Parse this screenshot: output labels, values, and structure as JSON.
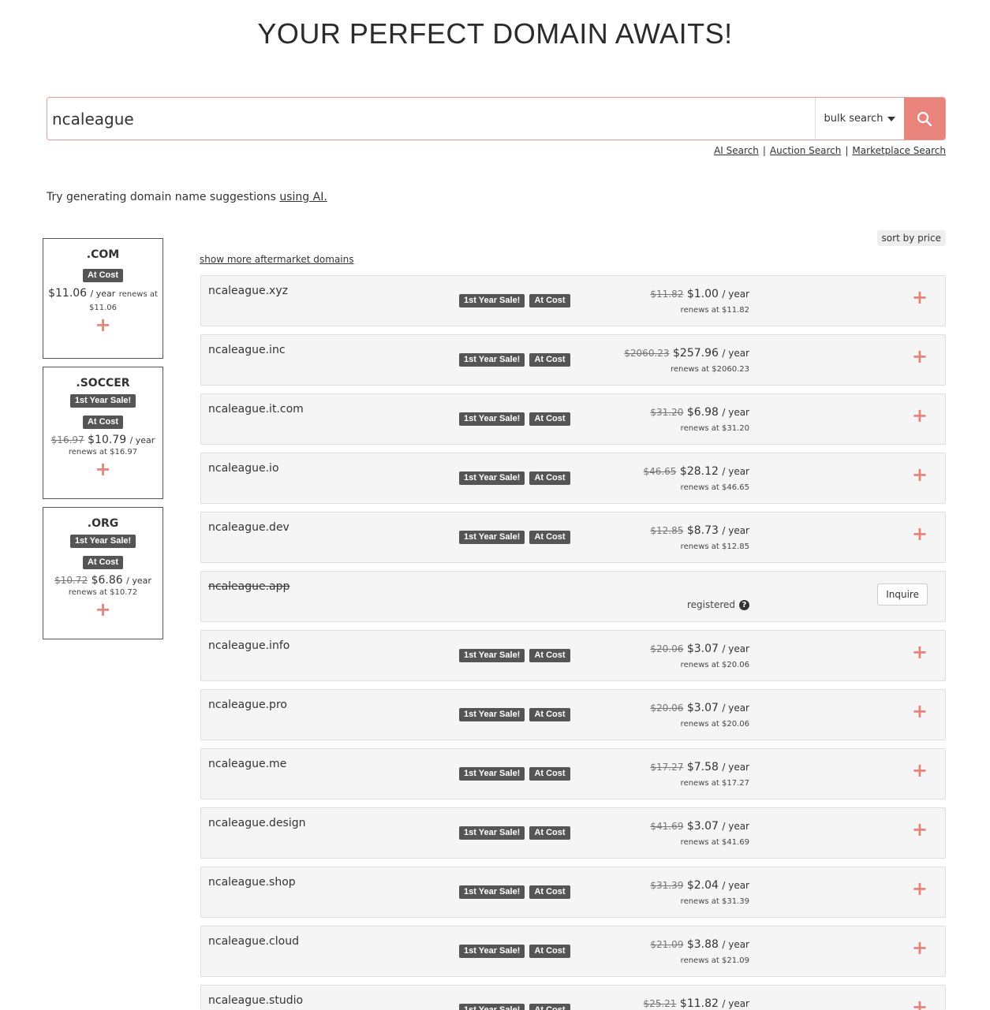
{
  "title": "YOUR PERFECT DOMAIN AWAITS!",
  "search": {
    "value": "ncaleague",
    "bulk_label": "bulk search",
    "links": [
      "AI Search",
      "Auction Search",
      "Marketplace Search"
    ]
  },
  "ai_hint": {
    "text": "Try generating domain name suggestions",
    "link": "using AI."
  },
  "tld_cards": [
    {
      "tld": ".COM",
      "badges": [
        "At Cost"
      ],
      "old_price": "",
      "price": "$11.06",
      "per": "/ year",
      "renews": "renews at $11.06"
    },
    {
      "tld": ".SOCCER",
      "badges": [
        "1st Year Sale!",
        "At Cost"
      ],
      "old_price": "$16.97",
      "price": "$10.79",
      "per": "/ year",
      "renews": "renews at $16.97"
    },
    {
      "tld": ".ORG",
      "badges": [
        "1st Year Sale!",
        "At Cost"
      ],
      "old_price": "$10.72",
      "price": "$6.86",
      "per": "/ year",
      "renews": "renews at $10.72"
    }
  ],
  "sort_label": "sort by price",
  "more_link": "show more aftermarket domains",
  "badge_labels": {
    "sale": "1st Year Sale!",
    "cost": "At Cost"
  },
  "per_year": "/ year",
  "results": [
    {
      "domain": "ncaleague.xyz",
      "old": "$11.82",
      "price": "$1.00",
      "renews": "renews at $11.82"
    },
    {
      "domain": "ncaleague.inc",
      "old": "$2060.23",
      "price": "$257.96",
      "renews": "renews at $2060.23"
    },
    {
      "domain": "ncaleague.it.com",
      "old": "$31.20",
      "price": "$6.98",
      "renews": "renews at $31.20"
    },
    {
      "domain": "ncaleague.io",
      "old": "$46.65",
      "price": "$28.12",
      "renews": "renews at $46.65"
    },
    {
      "domain": "ncaleague.dev",
      "old": "$12.85",
      "price": "$8.73",
      "renews": "renews at $12.85"
    },
    {
      "domain": "ncaleague.app",
      "registered": true,
      "status": "registered",
      "action": "Inquire"
    },
    {
      "domain": "ncaleague.info",
      "old": "$20.06",
      "price": "$3.07",
      "renews": "renews at $20.06"
    },
    {
      "domain": "ncaleague.pro",
      "old": "$20.06",
      "price": "$3.07",
      "renews": "renews at $20.06"
    },
    {
      "domain": "ncaleague.me",
      "old": "$17.27",
      "price": "$7.58",
      "renews": "renews at $17.27"
    },
    {
      "domain": "ncaleague.design",
      "old": "$41.69",
      "price": "$3.07",
      "renews": "renews at $41.69"
    },
    {
      "domain": "ncaleague.shop",
      "old": "$31.39",
      "price": "$2.04",
      "renews": "renews at $31.39"
    },
    {
      "domain": "ncaleague.cloud",
      "old": "$21.09",
      "price": "$3.88",
      "renews": "renews at $21.09"
    },
    {
      "domain": "ncaleague.studio",
      "old": "$25.21",
      "price": "$11.82",
      "renews": ""
    }
  ],
  "colors": {
    "accent": "#e8847c",
    "badge": "#555555"
  }
}
